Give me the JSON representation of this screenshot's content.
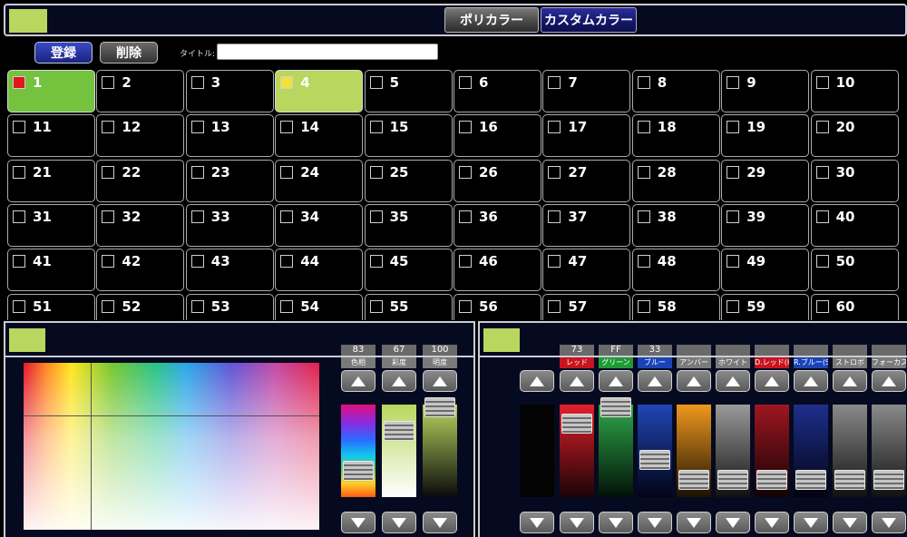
{
  "header": {
    "swatch_color": "#b9d65e",
    "tabs": [
      {
        "label": "ポリカラー",
        "active": false
      },
      {
        "label": "カスタムカラー",
        "active": true
      }
    ]
  },
  "toolbar": {
    "register_label": "登録",
    "delete_label": "削除",
    "title_label": "タイトル:",
    "title_value": ""
  },
  "grid": {
    "cells": [
      {
        "n": "1",
        "color": "#74c23e",
        "box": "#e01818"
      },
      {
        "n": "2"
      },
      {
        "n": "3"
      },
      {
        "n": "4",
        "color": "#b9d65e",
        "box": "#f1e23a"
      },
      {
        "n": "5"
      },
      {
        "n": "6"
      },
      {
        "n": "7"
      },
      {
        "n": "8"
      },
      {
        "n": "9"
      },
      {
        "n": "10"
      },
      {
        "n": "11"
      },
      {
        "n": "12"
      },
      {
        "n": "13"
      },
      {
        "n": "14"
      },
      {
        "n": "15"
      },
      {
        "n": "16"
      },
      {
        "n": "17"
      },
      {
        "n": "18"
      },
      {
        "n": "19"
      },
      {
        "n": "20"
      },
      {
        "n": "21"
      },
      {
        "n": "22"
      },
      {
        "n": "23"
      },
      {
        "n": "24"
      },
      {
        "n": "25"
      },
      {
        "n": "26"
      },
      {
        "n": "27"
      },
      {
        "n": "28"
      },
      {
        "n": "29"
      },
      {
        "n": "30"
      },
      {
        "n": "31"
      },
      {
        "n": "32"
      },
      {
        "n": "33"
      },
      {
        "n": "34"
      },
      {
        "n": "35"
      },
      {
        "n": "36"
      },
      {
        "n": "37"
      },
      {
        "n": "38"
      },
      {
        "n": "39"
      },
      {
        "n": "40"
      },
      {
        "n": "41"
      },
      {
        "n": "42"
      },
      {
        "n": "43"
      },
      {
        "n": "44"
      },
      {
        "n": "45"
      },
      {
        "n": "46"
      },
      {
        "n": "47"
      },
      {
        "n": "48"
      },
      {
        "n": "49"
      },
      {
        "n": "50"
      },
      {
        "n": "51"
      },
      {
        "n": "52"
      },
      {
        "n": "53"
      },
      {
        "n": "54"
      },
      {
        "n": "55"
      },
      {
        "n": "56"
      },
      {
        "n": "57"
      },
      {
        "n": "58"
      },
      {
        "n": "59"
      },
      {
        "n": "60"
      }
    ]
  },
  "hsb_panel": {
    "swatch_color": "#b9d65e",
    "sliders": [
      {
        "key": "hue",
        "label": "色相",
        "value": "83",
        "level": 0.12
      },
      {
        "key": "saturation",
        "label": "彩度",
        "value": "67",
        "level": 0.67
      },
      {
        "key": "brightness",
        "label": "明度",
        "value": "100",
        "level": 1.0
      }
    ]
  },
  "rgb_panel": {
    "swatch_color": "#b9d65e",
    "sliders": [
      {
        "key": "red",
        "label": "レッド",
        "value": "73",
        "level": 0.78,
        "top": "#e3202c",
        "bottom": "#1a0305",
        "lbl": "red"
      },
      {
        "key": "green",
        "label": "グリーン",
        "value": "FF",
        "level": 1.0,
        "top": "#2ea84a",
        "bottom": "#031107",
        "lbl": "green"
      },
      {
        "key": "blue",
        "label": "ブルー",
        "value": "33",
        "level": 0.27,
        "top": "#1f46b4",
        "bottom": "#020416",
        "lbl": "blue"
      },
      {
        "key": "amber",
        "label": "アンバー",
        "value": "",
        "level": 0,
        "top": "#f0981d",
        "bottom": "#1c1103",
        "lbl": "dark"
      },
      {
        "key": "white",
        "label": "ホワイト",
        "value": "",
        "level": 0,
        "top": "#9a9a9a",
        "bottom": "#111",
        "lbl": "dark"
      },
      {
        "key": "deep_red",
        "label": "D.レッド(H)",
        "value": "",
        "level": 0,
        "top": "#9e1621",
        "bottom": "#120204",
        "lbl": "red"
      },
      {
        "key": "royal_blue",
        "label": "R.ブルー(S)",
        "value": "",
        "level": 0,
        "top": "#1e2f8c",
        "bottom": "#020311",
        "lbl": "blue"
      },
      {
        "key": "strobe",
        "label": "ストロボ",
        "value": "",
        "level": 0,
        "top": "#8a8a8a",
        "bottom": "#111",
        "lbl": "dark"
      },
      {
        "key": "focus",
        "label": "フォーカス(C)",
        "value": "",
        "level": 0,
        "top": "#8a8a8a",
        "bottom": "#111",
        "lbl": "dark"
      }
    ]
  }
}
